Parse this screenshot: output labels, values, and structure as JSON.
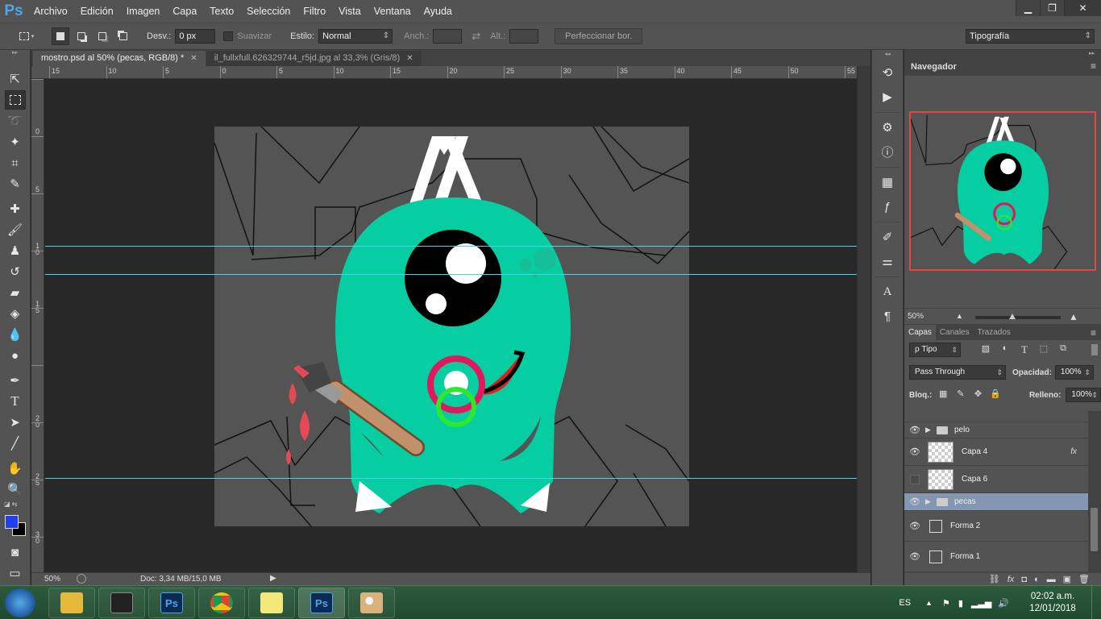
{
  "app": {
    "logo": "Ps"
  },
  "menu": [
    "Archivo",
    "Edición",
    "Imagen",
    "Capa",
    "Texto",
    "Selección",
    "Filtro",
    "Vista",
    "Ventana",
    "Ayuda"
  ],
  "window_controls": {
    "minimize": "▁",
    "restore": "❐",
    "close": "✕"
  },
  "options_bar": {
    "feather_label": "Desv.:",
    "feather_value": "0 px",
    "antialias_label": "Suavizar",
    "style_label": "Estilo:",
    "style_value": "Normal",
    "width_label": "Anch.:",
    "height_label": "Alt.:",
    "refine_button": "Perfeccionar bor.",
    "workspace_value": "Tipografía"
  },
  "tabs": [
    {
      "label": "mostro.psd al 50% (pecas, RGB/8) *"
    },
    {
      "label": "il_fullxfull.626329744_r5jd.jpg al 33,3% (Gris/8)"
    }
  ],
  "ruler_top": [
    "15",
    "10",
    "5",
    "0",
    "5",
    "10",
    "15",
    "20",
    "25",
    "30",
    "35",
    "40",
    "45",
    "50",
    "55"
  ],
  "ruler_left": [
    "0",
    "5",
    "1",
    "0",
    "1",
    "5",
    "2",
    "0",
    "2",
    "5",
    "3",
    "0",
    "3",
    "5"
  ],
  "status": {
    "zoom": "50%",
    "doc": "Doc: 3,34 MB/15,0 MB"
  },
  "navigator": {
    "title": "Navegador",
    "zoom": "50%"
  },
  "layers_panel": {
    "tabs": [
      "Capas",
      "Canales",
      "Trazados"
    ],
    "filter": "ρ Tipo",
    "blend_mode": "Pass Through",
    "opacity_label": "Opacidad:",
    "opacity_value": "100%",
    "lock_label": "Bloq.:",
    "fill_label": "Relleno:",
    "fill_value": "100%",
    "layers": [
      {
        "name": "pelo",
        "kind": "group",
        "visible": true,
        "selected": false
      },
      {
        "name": "Capa 4",
        "kind": "pixel",
        "visible": true,
        "selected": false,
        "fx": "fx"
      },
      {
        "name": "Capa 6",
        "kind": "pixel",
        "visible": false,
        "selected": false
      },
      {
        "name": "pecas",
        "kind": "group",
        "visible": true,
        "selected": true
      },
      {
        "name": "Forma 2",
        "kind": "shape",
        "visible": true,
        "selected": false
      },
      {
        "name": "Forma 1",
        "kind": "shape",
        "visible": true,
        "selected": false
      }
    ]
  },
  "taskbar": {
    "language": "ES",
    "time": "02:02 a.m.",
    "date": "12/01/2018",
    "ps_label": "Ps"
  },
  "colors": {
    "foreground": "#1f3ff0",
    "background": "#000000",
    "monster": "#06cda2",
    "artboard_bg": "#545454",
    "guides": "#41d9e6",
    "accent_pink": "#e0185c",
    "accent_green": "#2ee82e"
  }
}
